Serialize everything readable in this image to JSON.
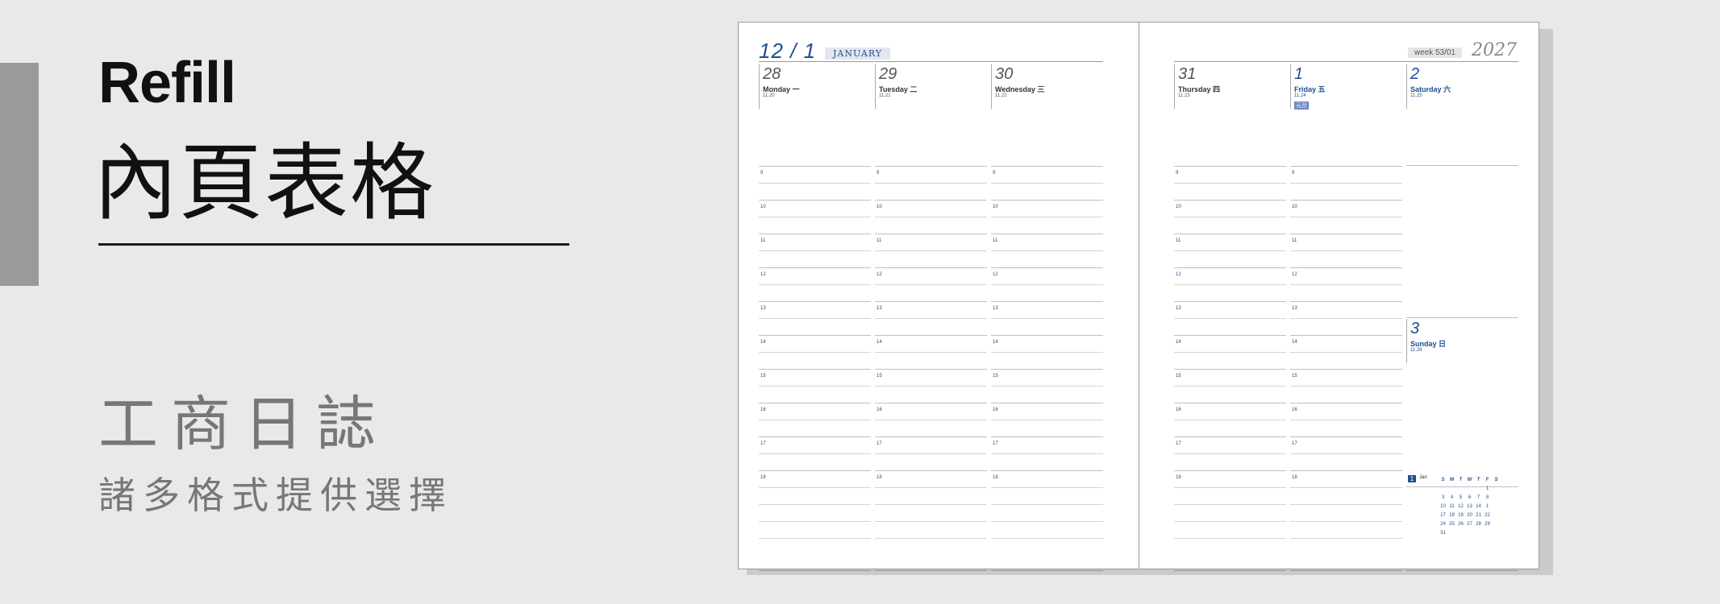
{
  "panel": {
    "refill": "Refill",
    "title": "內頁表格",
    "subtitle": "工商日誌",
    "tagline": "諸多格式提供選擇"
  },
  "header": {
    "date": "12 / 1",
    "month": "JANUARY",
    "week": "week  53/01",
    "year": "2027"
  },
  "left_days": [
    {
      "num": "28",
      "name": "Monday 一",
      "sub": "11.20"
    },
    {
      "num": "29",
      "name": "Tuesday 二",
      "sub": "11.21"
    },
    {
      "num": "30",
      "name": "Wednesday 三",
      "sub": "11.22"
    }
  ],
  "right_days": [
    {
      "num": "31",
      "name": "Thursday 四",
      "sub": "11.23"
    },
    {
      "num": "1",
      "name": "Friday 五",
      "sub": "11.24",
      "holiday": "元旦"
    }
  ],
  "saturday": {
    "num": "2",
    "name": "Saturday 六",
    "sub": "11.25"
  },
  "sunday": {
    "num": "3",
    "name": "Sunday 日",
    "sub": "11.26"
  },
  "hours": [
    "9",
    "10",
    "11",
    "12",
    "13",
    "14",
    "15",
    "16",
    "17",
    "18"
  ],
  "mini_calendar": {
    "month_num": "1",
    "month": "Jan",
    "weekdays": [
      "S",
      "M",
      "T",
      "W",
      "T",
      "F",
      "S"
    ],
    "weeks": [
      [
        "",
        "",
        "",
        "",
        "",
        "1",
        ""
      ],
      [
        "3",
        "4",
        "5",
        "6",
        "7",
        "8",
        ""
      ],
      [
        "10",
        "11",
        "12",
        "13",
        "14",
        "1",
        ""
      ],
      [
        "17",
        "18",
        "19",
        "20",
        "21",
        "22",
        ""
      ],
      [
        "24",
        "25",
        "26",
        "27",
        "28",
        "29",
        ""
      ],
      [
        "31",
        "",
        "",
        "",
        "",
        "",
        ""
      ]
    ]
  },
  "colors": {
    "accent": "#1d4f8f",
    "background": "#e8e9e9"
  }
}
